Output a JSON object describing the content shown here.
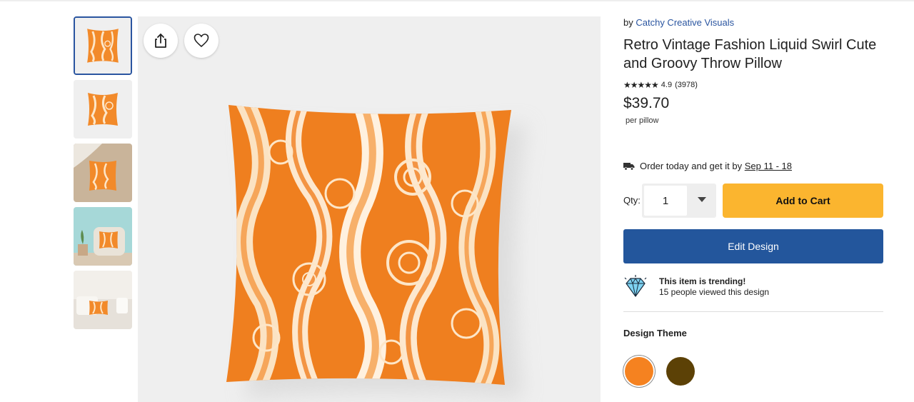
{
  "gallery": {
    "thumbnails": [
      {
        "name": "thumbnail-pillow-front",
        "active": true
      },
      {
        "name": "thumbnail-pillow-angle",
        "active": false
      },
      {
        "name": "thumbnail-pillow-blanket",
        "active": false
      },
      {
        "name": "thumbnail-pillow-chair",
        "active": false
      },
      {
        "name": "thumbnail-pillow-sofa",
        "active": false
      }
    ],
    "share_icon": "share-icon",
    "favorite_icon": "heart-icon"
  },
  "product": {
    "by_prefix": "by",
    "seller": "Catchy Creative Visuals",
    "title": "Retro Vintage Fashion Liquid Swirl Cute and Groovy Throw Pillow",
    "stars": "★★★★★",
    "rating": "4.9",
    "review_count": "(3978)",
    "price": "$39.70",
    "per_unit": "per pillow"
  },
  "delivery": {
    "text": "Order today and get it by",
    "dates": "Sep 11 - 18",
    "icon": "truck-icon"
  },
  "purchase": {
    "qty_label": "Qty:",
    "qty_value": "1",
    "add_to_cart": "Add to Cart",
    "edit_design": "Edit Design"
  },
  "trending": {
    "icon": "diamond-icon",
    "headline": "This item is trending!",
    "detail": "15 people viewed this design"
  },
  "design_theme": {
    "heading": "Design Theme",
    "swatches": [
      {
        "name": "orange",
        "color": "#f58220",
        "selected": true
      },
      {
        "name": "brown",
        "color": "#5c4106",
        "selected": false
      }
    ]
  },
  "colors": {
    "accent_blue": "#23569c",
    "cart_yellow": "#fbb52f",
    "link_blue": "#2a55a0"
  }
}
